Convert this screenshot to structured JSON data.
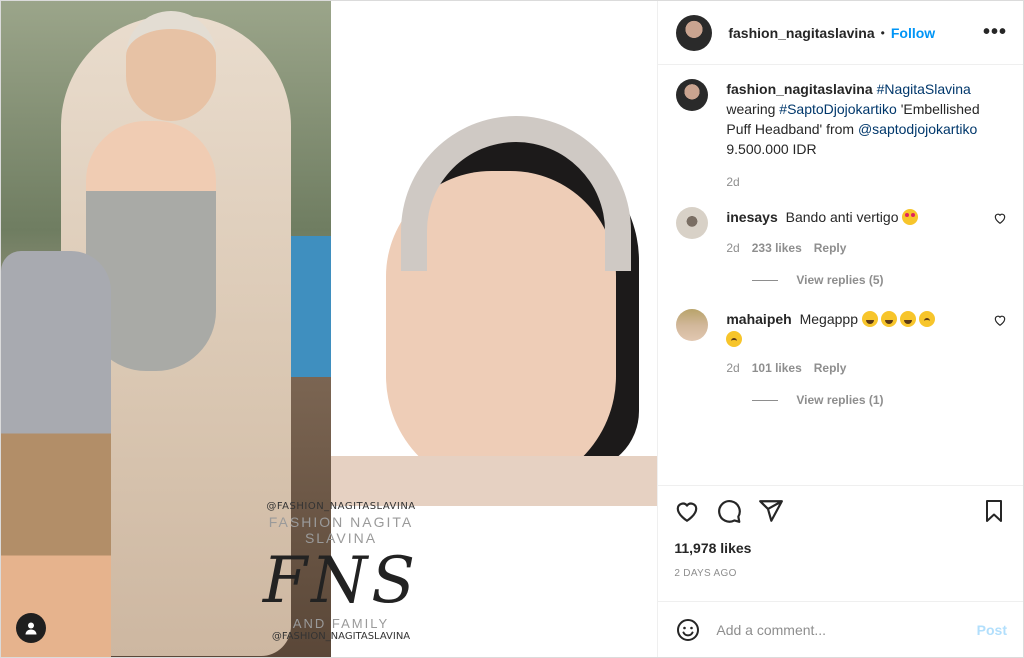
{
  "header": {
    "username": "fashion_nagitaslavina",
    "separator": "•",
    "follow_label": "Follow",
    "more_label": "•••"
  },
  "media": {
    "watermark_handle_top": "@FASHION_NAGITASLAVINA",
    "watermark_name": "FASHION NAGITA SLAVINA",
    "watermark_logo": "FNS",
    "watermark_family": "AND FAMILY",
    "watermark_handle_bottom": "@FASHION_NAGITASLAVINA",
    "user_tag_icon": "user-icon"
  },
  "caption": {
    "username": "fashion_nagitaslavina",
    "hashtag1": "#NagitaSlavina",
    "text1": "wearing",
    "hashtag2": "#SaptoDjojokartiko",
    "text2": "'Embellished Puff Headband' from",
    "mention": "@saptodjojokartiko",
    "text3": "9.500.000 IDR",
    "time": "2d"
  },
  "comments": [
    {
      "username": "inesays",
      "text": "Bando anti vertigo",
      "emoji": [
        "heart-eyes"
      ],
      "time": "2d",
      "likes": "233 likes",
      "reply_label": "Reply",
      "view_replies": "View replies (5)"
    },
    {
      "username": "mahaipeh",
      "text": "Megappp",
      "emoji": [
        "lol",
        "lol",
        "lol",
        "worried",
        "worried"
      ],
      "time": "2d",
      "likes": "101 likes",
      "reply_label": "Reply",
      "view_replies": "View replies (1)"
    }
  ],
  "actions": {
    "icons": [
      "heart-icon",
      "comment-icon",
      "share-icon",
      "bookmark-icon"
    ],
    "likes": "11,978 likes",
    "date": "2 DAYS AGO"
  },
  "add_comment": {
    "placeholder": "Add a comment...",
    "post_label": "Post",
    "emoji_icon": "smiley-icon"
  },
  "colors": {
    "accent": "#0095f6",
    "post_disabled": "#b2dffc",
    "muted": "#8e8e8e",
    "text": "#262626",
    "link": "#00376b"
  }
}
